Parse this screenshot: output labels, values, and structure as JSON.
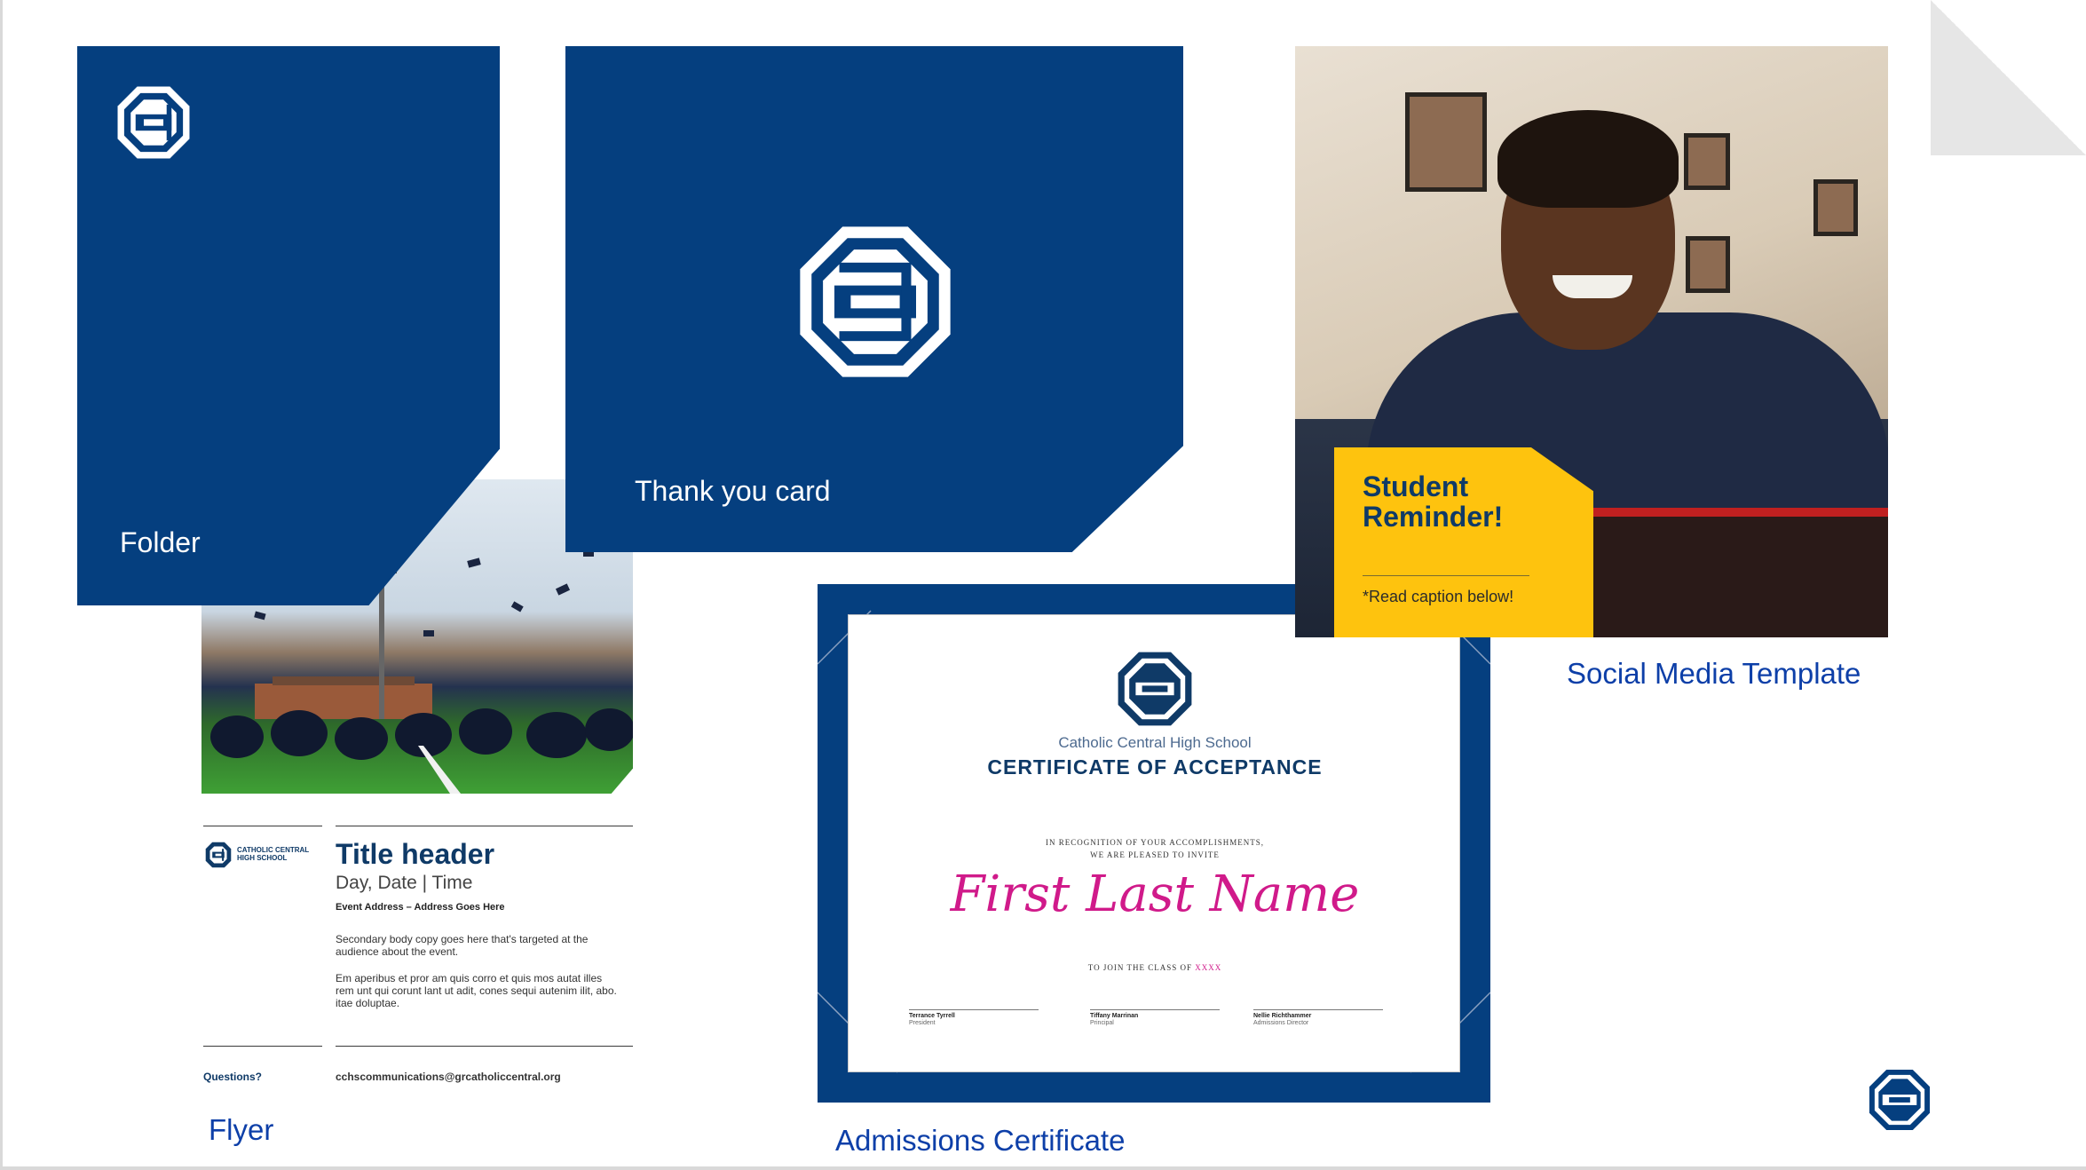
{
  "slide": {
    "folder": {
      "label": "Folder"
    },
    "thank_you_card": {
      "label": "Thank you card"
    },
    "social_media": {
      "reminder_title_line1": "Student",
      "reminder_title_line2": "Reminder!",
      "reminder_caption": "*Read caption below!",
      "label": "Social Media Template"
    },
    "flyer": {
      "school_name_line1": "CATHOLIC CENTRAL",
      "school_name_line2": "HIGH SCHOOL",
      "title": "Title header",
      "date_line": "Day, Date | Time",
      "address": "Event Address – Address Goes Here",
      "body_1": "Secondary body copy goes here that's targeted at the audience about the event.",
      "body_2": "Em aperibus et pror am quis corro et quis mos autat illes rem unt qui corunt lant ut adit, cones sequi autenim ilit, abo. itae doluptae.",
      "questions_label": "Questions?",
      "email": "cchscommunications@grcatholiccentral.org",
      "label": "Flyer"
    },
    "certificate": {
      "school": "Catholic Central High School",
      "title": "CERTIFICATE OF ACCEPTANCE",
      "recognition_line1": "IN RECOGNITION OF YOUR ACCOMPLISHMENTS,",
      "recognition_line2": "WE ARE PLEASED TO INVITE",
      "name": "First Last Name",
      "join_text": "TO JOIN THE CLASS OF",
      "class_year": "XXXX",
      "signatures": [
        {
          "name": "Terrance Tyrrell",
          "role": "President"
        },
        {
          "name": "Tiffany Marrinan",
          "role": "Principal"
        },
        {
          "name": "Nellie Richthammer",
          "role": "Admissions Director"
        }
      ],
      "label": "Admissions Certificate"
    },
    "colors": {
      "navy": "#053f7f",
      "yellow": "#fec30e",
      "label_blue": "#0d3fa8",
      "name_pink": "#d01a8a"
    },
    "icons": [
      "cc-logo-icon"
    ]
  }
}
